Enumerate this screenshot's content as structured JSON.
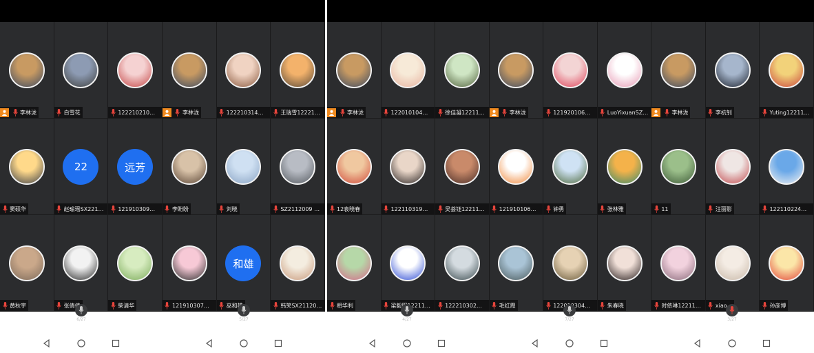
{
  "screens": [
    {
      "page_indicator": "6/27",
      "page_indicator_2": "5/27",
      "tiles": [
        {
          "label": "李林泷",
          "host": true,
          "avatar": "photo",
          "avatar_colors": [
            "#c89a62",
            "#3d4b63"
          ]
        },
        {
          "label": "白雪花",
          "host": false,
          "avatar": "photo",
          "avatar_colors": [
            "#8d9bb3",
            "#40413f"
          ]
        },
        {
          "label": "122210210王...",
          "host": false,
          "avatar": "photo",
          "avatar_colors": [
            "#f5d2d2",
            "#c44747"
          ]
        },
        {
          "label": "李林泷",
          "host": true,
          "avatar": "photo",
          "avatar_colors": [
            "#c89a62",
            "#3d4b63"
          ]
        },
        {
          "label": "122210314叶...",
          "host": false,
          "avatar": "photo",
          "avatar_colors": [
            "#f0d3c2",
            "#8a5a40"
          ]
        },
        {
          "label": "王瑞雪122210...",
          "host": false,
          "avatar": "photo",
          "avatar_colors": [
            "#f3b26b",
            "#5a4a3a"
          ]
        },
        {
          "label": "窦硕华",
          "host": false,
          "avatar": "photo",
          "avatar_colors": [
            "#ffd98a",
            "#3b3f48"
          ]
        },
        {
          "label": "赵瑜瑶SX2212...",
          "host": false,
          "avatar": "text",
          "avatar_text": "22"
        },
        {
          "label": "121910309辛...",
          "host": false,
          "avatar": "text",
          "avatar_text": "远芳"
        },
        {
          "label": "李盼盼",
          "host": false,
          "avatar": "photo",
          "avatar_colors": [
            "#d8c2a8",
            "#5b4636"
          ]
        },
        {
          "label": "刘晓",
          "host": false,
          "avatar": "photo",
          "avatar_colors": [
            "#cfe0f2",
            "#8aa4c4"
          ]
        },
        {
          "label": "SZ2112009 刘茵",
          "host": false,
          "avatar": "photo",
          "avatar_colors": [
            "#b8bcc4",
            "#555a60"
          ]
        },
        {
          "label": "黄秋宇",
          "host": false,
          "avatar": "none",
          "avatar_colors": [
            "#caa88a",
            "#7d6a5a"
          ]
        },
        {
          "label": "张倩倩",
          "host": false,
          "avatar": "photo",
          "avatar_colors": [
            "#f2f2f2",
            "#2c2c2c"
          ]
        },
        {
          "label": "柴清华",
          "host": false,
          "avatar": "photo",
          "avatar_colors": [
            "#d7ecc0",
            "#7cab5b"
          ]
        },
        {
          "label": "121910307陈漂",
          "host": false,
          "avatar": "photo",
          "avatar_colors": [
            "#f7c9d6",
            "#2f2f2f"
          ]
        },
        {
          "label": "巫和雄",
          "host": false,
          "avatar": "text",
          "avatar_text": "和雄"
        },
        {
          "label": "韩笑SX2112014",
          "host": false,
          "avatar": "none",
          "avatar_colors": [
            "#f4ede0",
            "#c99a7c"
          ]
        }
      ]
    },
    {
      "page_indicator": "4/27",
      "page_indicator_2": "7/27",
      "page_indicator_3": "3/27",
      "tiles": [
        {
          "label": "李林泷",
          "host": true,
          "avatar": "photo",
          "avatar_colors": [
            "#c89a62",
            "#3d4b63"
          ]
        },
        {
          "label": "122010104郑...",
          "host": false,
          "avatar": "photo",
          "avatar_colors": [
            "#f7ead8",
            "#e7b3a0"
          ]
        },
        {
          "label": "徐佳凝122110...",
          "host": false,
          "avatar": "photo",
          "avatar_colors": [
            "#cfe6c4",
            "#54643f"
          ]
        },
        {
          "label": "李林泷",
          "host": true,
          "avatar": "photo",
          "avatar_colors": [
            "#c89a62",
            "#3d4b63"
          ]
        },
        {
          "label": "121920106杜...",
          "host": false,
          "avatar": "photo",
          "avatar_colors": [
            "#f3d4d4",
            "#e0435a"
          ]
        },
        {
          "label": "LuoYixuanSZ2...",
          "host": false,
          "avatar": "photo",
          "avatar_colors": [
            "#ffffff",
            "#e79ab4"
          ]
        },
        {
          "label": "李林泷",
          "host": true,
          "avatar": "photo",
          "avatar_colors": [
            "#c89a62",
            "#3d4b63"
          ]
        },
        {
          "label": "李杭钊",
          "host": false,
          "avatar": "photo",
          "avatar_colors": [
            "#a6b6cc",
            "#1e2430"
          ]
        },
        {
          "label": "Yuting122110...",
          "host": false,
          "avatar": "photo",
          "avatar_colors": [
            "#f2d27a",
            "#c9473d"
          ]
        },
        {
          "label": "12袁晓春",
          "host": false,
          "avatar": "none",
          "avatar_colors": [
            "#f0c8a0",
            "#d04a3a"
          ]
        },
        {
          "label": "122110319姚...",
          "host": false,
          "avatar": "photo",
          "avatar_colors": [
            "#e9d6c8",
            "#2b2524"
          ]
        },
        {
          "label": "吴荟钰122110...",
          "host": false,
          "avatar": "photo",
          "avatar_colors": [
            "#c98a6a",
            "#4a2e28"
          ]
        },
        {
          "label": "121910106李...",
          "host": false,
          "avatar": "photo",
          "avatar_colors": [
            "#ffffff",
            "#f0883a"
          ]
        },
        {
          "label": "钟勇",
          "host": false,
          "avatar": "photo",
          "avatar_colors": [
            "#cfe2f4",
            "#4f6a3e"
          ]
        },
        {
          "label": "张林雅",
          "host": false,
          "avatar": "photo",
          "avatar_colors": [
            "#f4b24a",
            "#3a8a6a"
          ]
        },
        {
          "label": "11",
          "host": false,
          "avatar": "none",
          "avatar_colors": [
            "#9bbf8a",
            "#3e5a38"
          ]
        },
        {
          "label": "汪丽影",
          "host": false,
          "avatar": "photo",
          "avatar_colors": [
            "#efe6e4",
            "#c24a4e"
          ]
        },
        {
          "label": "122110224易...",
          "host": false,
          "avatar": "photo",
          "avatar_colors": [
            "#6aa8e8",
            "#f0f0f0"
          ]
        },
        {
          "label": "相华利",
          "host": false,
          "avatar": "photo",
          "avatar_colors": [
            "#b6d8a8",
            "#d46a8a"
          ]
        },
        {
          "label": "梁毅阳122110...",
          "host": false,
          "avatar": "photo",
          "avatar_colors": [
            "#ffffff",
            "#2b4ad4"
          ]
        },
        {
          "label": "122210302褚...",
          "host": false,
          "avatar": "photo",
          "avatar_colors": [
            "#d4dbe0",
            "#3a4a4e"
          ]
        },
        {
          "label": "毛红霞",
          "host": false,
          "avatar": "none",
          "avatar_colors": [
            "#aac4d6",
            "#4a5a5c"
          ]
        },
        {
          "label": "122010304周...",
          "host": false,
          "avatar": "photo",
          "avatar_colors": [
            "#e6d2b4",
            "#6a5a3a"
          ]
        },
        {
          "label": "朱春晓",
          "host": false,
          "avatar": "none",
          "avatar_colors": [
            "#f1e0d8",
            "#2a2020"
          ]
        },
        {
          "label": "时依琳122110...",
          "host": false,
          "avatar": "photo",
          "avatar_colors": [
            "#f2d2de",
            "#8a6a7a"
          ]
        },
        {
          "label": "xiao...",
          "host": false,
          "avatar": "photo",
          "avatar_colors": [
            "#f4ece4",
            "#c8b8a8"
          ]
        },
        {
          "label": "孙彦博",
          "host": false,
          "avatar": "photo",
          "avatar_colors": [
            "#fbe6a8",
            "#e2463a"
          ]
        }
      ]
    }
  ],
  "nav": {
    "back": "back-triangle",
    "home": "home-circle",
    "recents": "recents-square"
  },
  "colors": {
    "tile_bg": "#2b2c2e",
    "host_badge": "#f08a1f",
    "mic_red": "#e8453c",
    "blue_avatar": "#1f6ff0"
  }
}
